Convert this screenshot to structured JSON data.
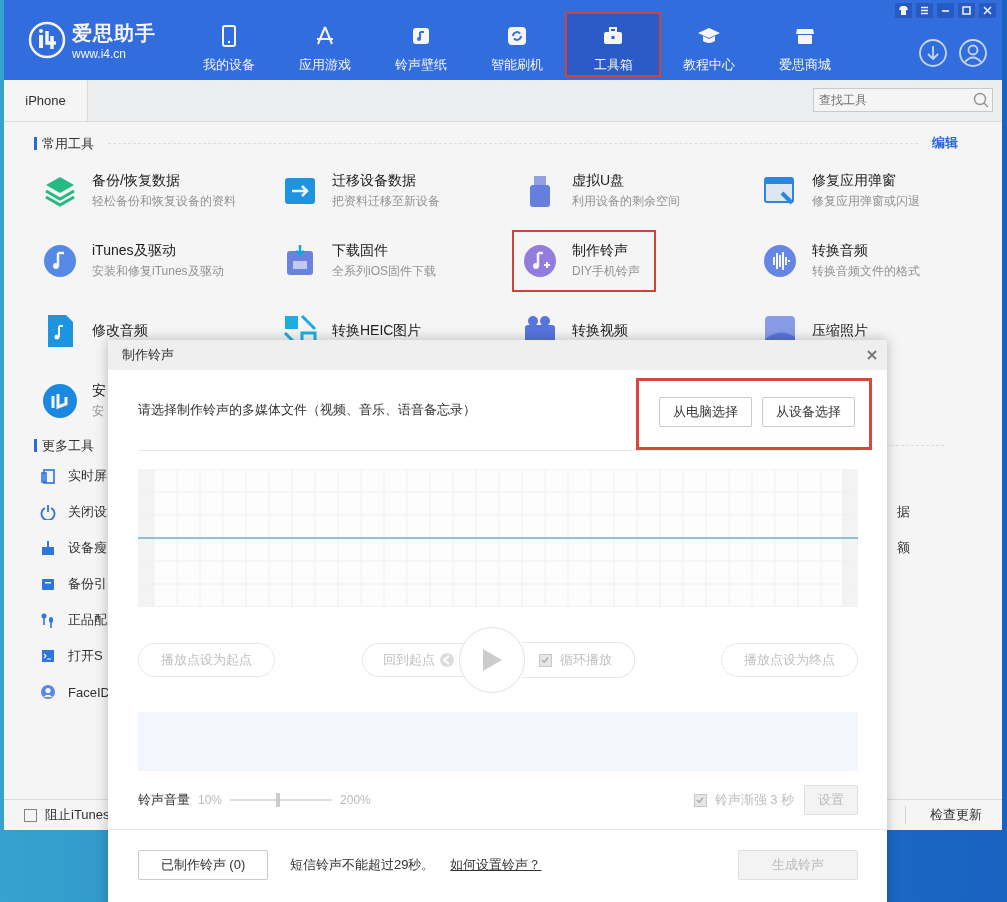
{
  "app": {
    "name": "爱思助手",
    "url": "www.i4.cn"
  },
  "nav": [
    {
      "label": "我的设备",
      "selected": false,
      "highlighted": false
    },
    {
      "label": "应用游戏",
      "selected": false,
      "highlighted": false
    },
    {
      "label": "铃声壁纸",
      "selected": false,
      "highlighted": false
    },
    {
      "label": "智能刷机",
      "selected": false,
      "highlighted": false
    },
    {
      "label": "工具箱",
      "selected": true,
      "highlighted": true
    },
    {
      "label": "教程中心",
      "selected": false,
      "highlighted": false
    },
    {
      "label": "爱思商城",
      "selected": false,
      "highlighted": false
    }
  ],
  "tabs": [
    {
      "label": "iPhone",
      "selected": true
    }
  ],
  "search": {
    "placeholder": "查找工具"
  },
  "common_tools": {
    "title": "常用工具",
    "edit": "编辑",
    "items": [
      {
        "title": "备份/恢复数据",
        "desc": "轻松备份和恢复设备的资料",
        "highlighted": false
      },
      {
        "title": "迁移设备数据",
        "desc": "把资料迁移至新设备",
        "highlighted": false
      },
      {
        "title": "虚拟U盘",
        "desc": "利用设备的剩余空间",
        "highlighted": false
      },
      {
        "title": "修复应用弹窗",
        "desc": "修复应用弹窗或闪退",
        "highlighted": false
      },
      {
        "title": "iTunes及驱动",
        "desc": "安装和修复iTunes及驱动",
        "highlighted": false
      },
      {
        "title": "下载固件",
        "desc": "全系列iOS固件下载",
        "highlighted": false
      },
      {
        "title": "制作铃声",
        "desc": "DIY手机铃声",
        "highlighted": true
      },
      {
        "title": "转换音频",
        "desc": "转换音频文件的格式",
        "highlighted": false
      },
      {
        "title": "修改音频",
        "highlighted": false
      },
      {
        "title": "转换HEIC图片",
        "highlighted": false
      },
      {
        "title": "转换视频",
        "highlighted": false
      },
      {
        "title": "压缩照片",
        "highlighted": false
      },
      {
        "title": "安",
        "desc": "安",
        "highlighted": false
      }
    ]
  },
  "more_tools": {
    "title": "更多工具",
    "items": [
      {
        "label": "实时屏"
      },
      {
        "label": "关闭设",
        "column_2": "据"
      },
      {
        "label": "设备瘦",
        "column_2": "额"
      },
      {
        "label": "备份引"
      },
      {
        "label": "正品配"
      },
      {
        "label": "打开S"
      },
      {
        "label": "FaceID"
      }
    ]
  },
  "status_bar": {
    "block_itunes": {
      "label": "阻止iTunes",
      "checked": false
    },
    "update": "检查更新"
  },
  "dialog": {
    "title": "制作铃声",
    "prompt": "请选择制作铃声的多媒体文件（视频、音乐、语音备忘录）",
    "source_buttons_highlighted": true,
    "source_buttons": [
      {
        "label": "从电脑选择",
        "disabled": false
      },
      {
        "label": "从设备选择",
        "disabled": false
      }
    ],
    "set_start": {
      "label": "播放点设为起点",
      "disabled": true
    },
    "back_to_start": {
      "label": "回到起点",
      "disabled": true
    },
    "loop": {
      "label": "循环播放",
      "checked": true,
      "disabled": true
    },
    "set_end": {
      "label": "播放点设为终点",
      "disabled": true
    },
    "volume": {
      "label": "铃声音量",
      "min": "10%",
      "max": "200%",
      "level": 0.47
    },
    "fade": {
      "label": "铃声渐强 3 秒",
      "checked": true,
      "disabled": true
    },
    "settings": {
      "label": "设置",
      "disabled": true
    },
    "made": {
      "label": "已制作铃声 (0)",
      "disabled": false
    },
    "note": "短信铃声不能超过29秒。",
    "help_link": "如何设置铃声？",
    "generate": {
      "label": "生成铃声",
      "disabled": true
    }
  }
}
